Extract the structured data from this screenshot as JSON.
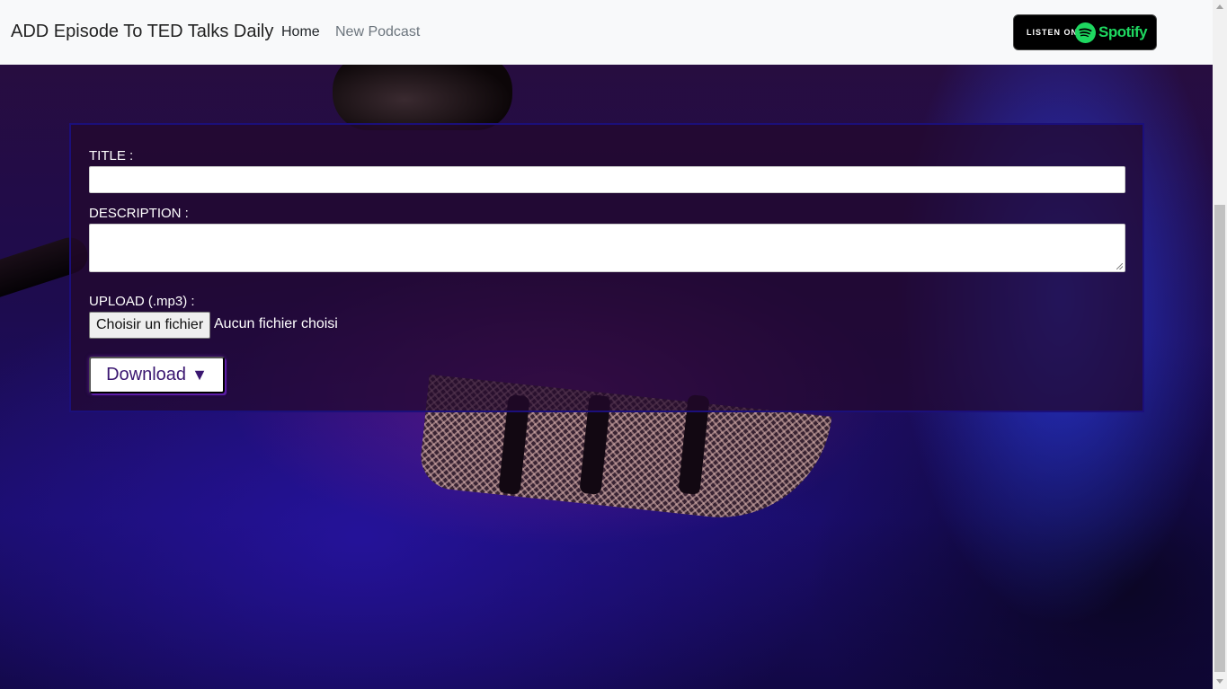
{
  "navbar": {
    "brand": "ADD Episode To TED Talks Daily",
    "links": [
      {
        "label": "Home",
        "active": true
      },
      {
        "label": "New Podcast",
        "active": false
      }
    ],
    "spotify_badge": {
      "prefix": "LISTEN ON",
      "brand": "Spotify",
      "icon": "spotify-icon",
      "brand_color": "#1ed760"
    }
  },
  "form": {
    "title_label": "TITLE :",
    "title_value": "",
    "description_label": "DESCRIPTION :",
    "description_value": "",
    "upload_label": "UPLOAD (.mp3) :",
    "file_button_label": "Choisir un fichier",
    "file_status": "Aucun fichier choisi",
    "submit_label": "Download",
    "submit_icon": "▼"
  },
  "colors": {
    "navbar_bg": "#f8f9fa",
    "panel_border": "#1b0f7a",
    "accent": "#3a1670"
  }
}
